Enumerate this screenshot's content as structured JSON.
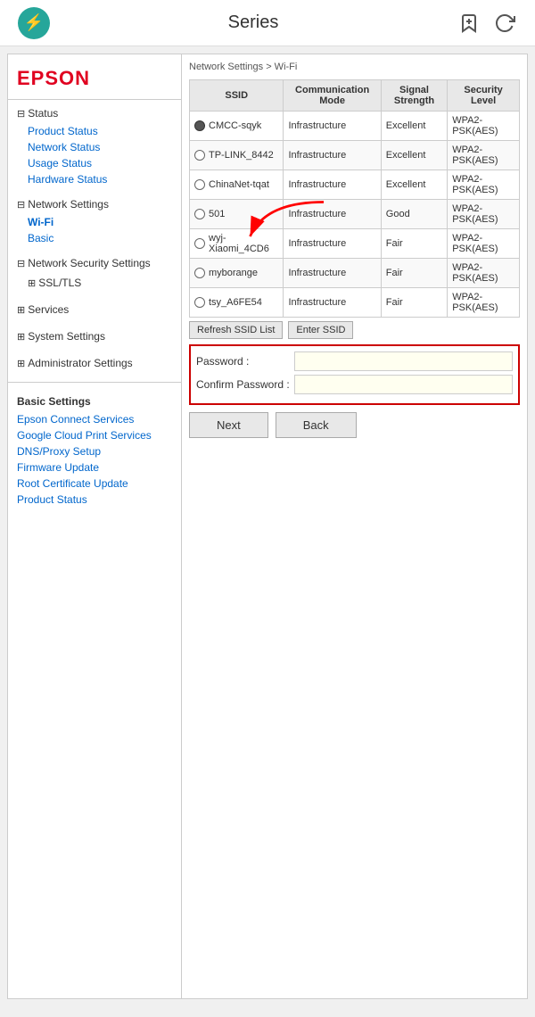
{
  "app": {
    "title": "Series",
    "brand_icon": "⚡"
  },
  "sidebar": {
    "brand": "EPSON",
    "sections": [
      {
        "header": "Status",
        "type": "minus",
        "links": [
          {
            "label": "Product Status",
            "active": false
          },
          {
            "label": "Network Status",
            "active": false
          },
          {
            "label": "Usage Status",
            "active": false
          },
          {
            "label": "Hardware Status",
            "active": false
          }
        ]
      },
      {
        "header": "Network Settings",
        "type": "minus",
        "links": [
          {
            "label": "Wi-Fi",
            "active": true
          },
          {
            "label": "Basic",
            "active": false
          }
        ]
      },
      {
        "header": "Network Security Settings",
        "type": "minus",
        "links": []
      },
      {
        "header": "SSL/TLS",
        "type": "plus",
        "links": [],
        "indent": true
      },
      {
        "header": "Services",
        "type": "plus",
        "links": []
      },
      {
        "header": "System Settings",
        "type": "plus",
        "links": []
      },
      {
        "header": "Administrator Settings",
        "type": "plus",
        "links": []
      }
    ],
    "basic_settings": {
      "header": "Basic Settings",
      "links": [
        "Epson Connect Services",
        "Google Cloud Print Services",
        "DNS/Proxy Setup",
        "Firmware Update",
        "Root Certificate Update",
        "Product Status"
      ]
    }
  },
  "content": {
    "page_title": "Series",
    "breadcrumb": "Network Settings > Wi-Fi",
    "table": {
      "headers": [
        "SSID",
        "Communication Mode",
        "Signal Strength",
        "Security Level"
      ],
      "rows": [
        {
          "ssid": "CMCC-sqyk",
          "mode": "Infrastructure",
          "signal": "Excellent",
          "security": "WPA2-PSK(AES)",
          "selected": true
        },
        {
          "ssid": "TP-LINK_8442",
          "mode": "Infrastructure",
          "signal": "Excellent",
          "security": "WPA2-PSK(AES)",
          "selected": false
        },
        {
          "ssid": "ChinaNet-tqat",
          "mode": "Infrastructure",
          "signal": "Excellent",
          "security": "WPA2-PSK(AES)",
          "selected": false
        },
        {
          "ssid": "501",
          "mode": "Infrastructure",
          "signal": "Good",
          "security": "WPA2-PSK(AES)",
          "selected": false
        },
        {
          "ssid": "wyj-Xiaomi_4CD6",
          "mode": "Infrastructure",
          "signal": "Fair",
          "security": "WPA2-PSK(AES)",
          "selected": false
        },
        {
          "ssid": "myborange",
          "mode": "Infrastructure",
          "signal": "Fair",
          "security": "WPA2-PSK(AES)",
          "selected": false
        },
        {
          "ssid": "tsy_A6FE54",
          "mode": "Infrastructure",
          "signal": "Fair",
          "security": "WPA2-PSK(AES)",
          "selected": false
        }
      ],
      "btn_refresh": "Refresh SSID List",
      "btn_enter": "Enter SSID"
    },
    "password_section": {
      "password_label": "Password :",
      "confirm_label": "Confirm Password :",
      "password_value": "",
      "confirm_value": ""
    },
    "buttons": {
      "next": "Next",
      "back": "Back"
    }
  }
}
